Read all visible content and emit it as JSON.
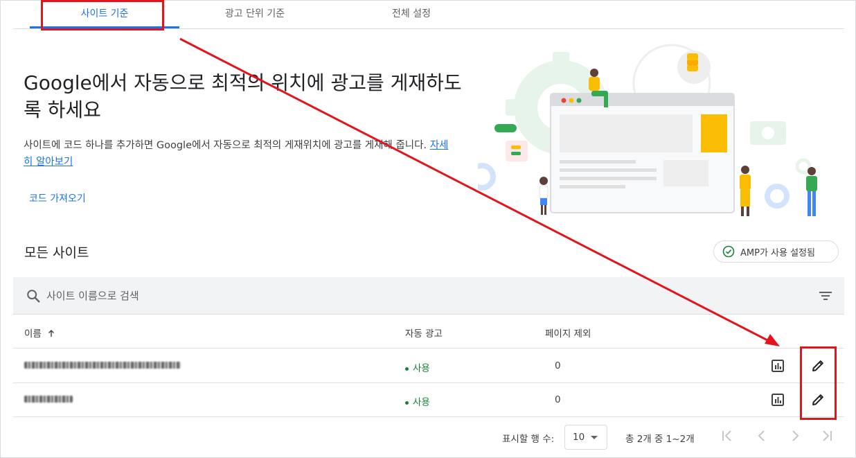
{
  "tabs": [
    {
      "label": "사이트 기준",
      "active": true
    },
    {
      "label": "광고 단위 기준",
      "active": false
    },
    {
      "label": "전체 설정",
      "active": false
    }
  ],
  "hero": {
    "title": "Google에서 자동으로 최적의 위치에 광고를 게재하도록 하세요",
    "desc_text": "사이트에 코드 하나를 추가하면 Google에서 자동으로 최적의 게재위치에 광고를 게재해 줍니다.",
    "learn_more": "자세히 알아보기",
    "get_code_button": "코드 가져오기"
  },
  "sites": {
    "title": "모든 사이트",
    "amp_chip": "AMP가 사용 설정됨",
    "search_placeholder": "사이트 이름으로 검색",
    "columns": {
      "name": "이름",
      "auto_ads": "자동 광고",
      "excluded_pages": "페이지 제외"
    },
    "rows": [
      {
        "status": "사용",
        "excluded": "0"
      },
      {
        "status": "사용",
        "excluded": "0"
      }
    ]
  },
  "pagination": {
    "rows_per_page_label": "표시할 행 수:",
    "rows_per_page_value": "10",
    "range_text": "총 2개 중 1~2개"
  },
  "colors": {
    "accent": "#1a73e8",
    "status_green": "#188038",
    "annotation_red": "#e3141b"
  }
}
